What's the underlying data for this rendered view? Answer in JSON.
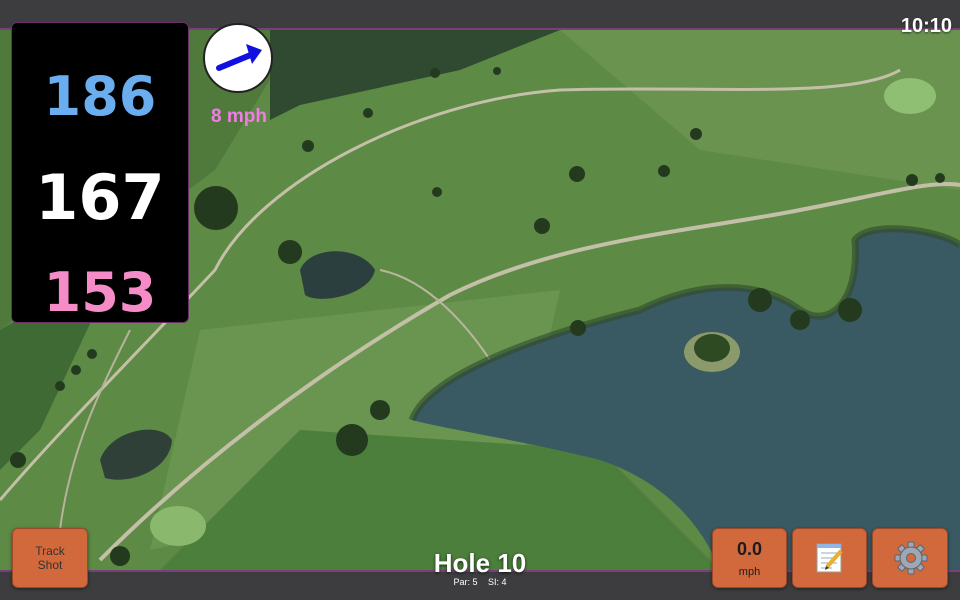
{
  "status": {
    "time": "10:10"
  },
  "distances": {
    "back": "186",
    "middle": "167",
    "front": "153",
    "colors": {
      "back": "#6aaef0",
      "middle": "#ffffff",
      "front": "#f58cc8"
    }
  },
  "wind": {
    "speed": "8 mph",
    "direction_icon": "wind-arrow-icon",
    "color": "#f27be6",
    "arrow_color": "#1010e0"
  },
  "track_shot": {
    "label": "Track\nShot"
  },
  "speed": {
    "value": "0.0",
    "unit": "mph"
  },
  "toolbar": {
    "notes_icon": "notepad-icon",
    "settings_icon": "gear-icon"
  },
  "hole": {
    "title": "Hole 10",
    "par": "Par: 5",
    "si": "SI: 4"
  },
  "theme": {
    "button_color": "#d2693c",
    "bar_color": "#3d3d3f",
    "accent_border": "#7a3e7a"
  }
}
